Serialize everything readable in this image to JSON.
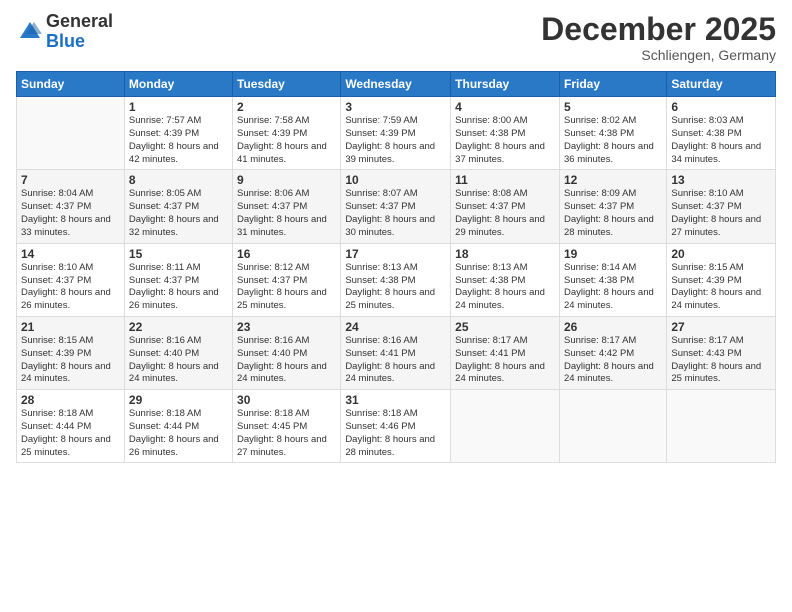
{
  "header": {
    "logo_general": "General",
    "logo_blue": "Blue",
    "month_title": "December 2025",
    "location": "Schliengen, Germany"
  },
  "days_of_week": [
    "Sunday",
    "Monday",
    "Tuesday",
    "Wednesday",
    "Thursday",
    "Friday",
    "Saturday"
  ],
  "weeks": [
    [
      {
        "day": "",
        "sunrise": "",
        "sunset": "",
        "daylight": ""
      },
      {
        "day": "1",
        "sunrise": "Sunrise: 7:57 AM",
        "sunset": "Sunset: 4:39 PM",
        "daylight": "Daylight: 8 hours and 42 minutes."
      },
      {
        "day": "2",
        "sunrise": "Sunrise: 7:58 AM",
        "sunset": "Sunset: 4:39 PM",
        "daylight": "Daylight: 8 hours and 41 minutes."
      },
      {
        "day": "3",
        "sunrise": "Sunrise: 7:59 AM",
        "sunset": "Sunset: 4:39 PM",
        "daylight": "Daylight: 8 hours and 39 minutes."
      },
      {
        "day": "4",
        "sunrise": "Sunrise: 8:00 AM",
        "sunset": "Sunset: 4:38 PM",
        "daylight": "Daylight: 8 hours and 37 minutes."
      },
      {
        "day": "5",
        "sunrise": "Sunrise: 8:02 AM",
        "sunset": "Sunset: 4:38 PM",
        "daylight": "Daylight: 8 hours and 36 minutes."
      },
      {
        "day": "6",
        "sunrise": "Sunrise: 8:03 AM",
        "sunset": "Sunset: 4:38 PM",
        "daylight": "Daylight: 8 hours and 34 minutes."
      }
    ],
    [
      {
        "day": "7",
        "sunrise": "Sunrise: 8:04 AM",
        "sunset": "Sunset: 4:37 PM",
        "daylight": "Daylight: 8 hours and 33 minutes."
      },
      {
        "day": "8",
        "sunrise": "Sunrise: 8:05 AM",
        "sunset": "Sunset: 4:37 PM",
        "daylight": "Daylight: 8 hours and 32 minutes."
      },
      {
        "day": "9",
        "sunrise": "Sunrise: 8:06 AM",
        "sunset": "Sunset: 4:37 PM",
        "daylight": "Daylight: 8 hours and 31 minutes."
      },
      {
        "day": "10",
        "sunrise": "Sunrise: 8:07 AM",
        "sunset": "Sunset: 4:37 PM",
        "daylight": "Daylight: 8 hours and 30 minutes."
      },
      {
        "day": "11",
        "sunrise": "Sunrise: 8:08 AM",
        "sunset": "Sunset: 4:37 PM",
        "daylight": "Daylight: 8 hours and 29 minutes."
      },
      {
        "day": "12",
        "sunrise": "Sunrise: 8:09 AM",
        "sunset": "Sunset: 4:37 PM",
        "daylight": "Daylight: 8 hours and 28 minutes."
      },
      {
        "day": "13",
        "sunrise": "Sunrise: 8:10 AM",
        "sunset": "Sunset: 4:37 PM",
        "daylight": "Daylight: 8 hours and 27 minutes."
      }
    ],
    [
      {
        "day": "14",
        "sunrise": "Sunrise: 8:10 AM",
        "sunset": "Sunset: 4:37 PM",
        "daylight": "Daylight: 8 hours and 26 minutes."
      },
      {
        "day": "15",
        "sunrise": "Sunrise: 8:11 AM",
        "sunset": "Sunset: 4:37 PM",
        "daylight": "Daylight: 8 hours and 26 minutes."
      },
      {
        "day": "16",
        "sunrise": "Sunrise: 8:12 AM",
        "sunset": "Sunset: 4:37 PM",
        "daylight": "Daylight: 8 hours and 25 minutes."
      },
      {
        "day": "17",
        "sunrise": "Sunrise: 8:13 AM",
        "sunset": "Sunset: 4:38 PM",
        "daylight": "Daylight: 8 hours and 25 minutes."
      },
      {
        "day": "18",
        "sunrise": "Sunrise: 8:13 AM",
        "sunset": "Sunset: 4:38 PM",
        "daylight": "Daylight: 8 hours and 24 minutes."
      },
      {
        "day": "19",
        "sunrise": "Sunrise: 8:14 AM",
        "sunset": "Sunset: 4:38 PM",
        "daylight": "Daylight: 8 hours and 24 minutes."
      },
      {
        "day": "20",
        "sunrise": "Sunrise: 8:15 AM",
        "sunset": "Sunset: 4:39 PM",
        "daylight": "Daylight: 8 hours and 24 minutes."
      }
    ],
    [
      {
        "day": "21",
        "sunrise": "Sunrise: 8:15 AM",
        "sunset": "Sunset: 4:39 PM",
        "daylight": "Daylight: 8 hours and 24 minutes."
      },
      {
        "day": "22",
        "sunrise": "Sunrise: 8:16 AM",
        "sunset": "Sunset: 4:40 PM",
        "daylight": "Daylight: 8 hours and 24 minutes."
      },
      {
        "day": "23",
        "sunrise": "Sunrise: 8:16 AM",
        "sunset": "Sunset: 4:40 PM",
        "daylight": "Daylight: 8 hours and 24 minutes."
      },
      {
        "day": "24",
        "sunrise": "Sunrise: 8:16 AM",
        "sunset": "Sunset: 4:41 PM",
        "daylight": "Daylight: 8 hours and 24 minutes."
      },
      {
        "day": "25",
        "sunrise": "Sunrise: 8:17 AM",
        "sunset": "Sunset: 4:41 PM",
        "daylight": "Daylight: 8 hours and 24 minutes."
      },
      {
        "day": "26",
        "sunrise": "Sunrise: 8:17 AM",
        "sunset": "Sunset: 4:42 PM",
        "daylight": "Daylight: 8 hours and 24 minutes."
      },
      {
        "day": "27",
        "sunrise": "Sunrise: 8:17 AM",
        "sunset": "Sunset: 4:43 PM",
        "daylight": "Daylight: 8 hours and 25 minutes."
      }
    ],
    [
      {
        "day": "28",
        "sunrise": "Sunrise: 8:18 AM",
        "sunset": "Sunset: 4:44 PM",
        "daylight": "Daylight: 8 hours and 25 minutes."
      },
      {
        "day": "29",
        "sunrise": "Sunrise: 8:18 AM",
        "sunset": "Sunset: 4:44 PM",
        "daylight": "Daylight: 8 hours and 26 minutes."
      },
      {
        "day": "30",
        "sunrise": "Sunrise: 8:18 AM",
        "sunset": "Sunset: 4:45 PM",
        "daylight": "Daylight: 8 hours and 27 minutes."
      },
      {
        "day": "31",
        "sunrise": "Sunrise: 8:18 AM",
        "sunset": "Sunset: 4:46 PM",
        "daylight": "Daylight: 8 hours and 28 minutes."
      },
      {
        "day": "",
        "sunrise": "",
        "sunset": "",
        "daylight": ""
      },
      {
        "day": "",
        "sunrise": "",
        "sunset": "",
        "daylight": ""
      },
      {
        "day": "",
        "sunrise": "",
        "sunset": "",
        "daylight": ""
      }
    ]
  ]
}
